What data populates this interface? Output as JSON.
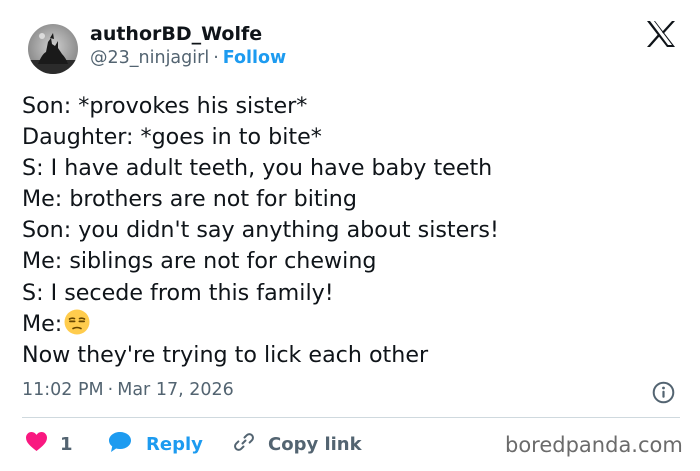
{
  "author": {
    "display_name": "authorBD_Wolfe",
    "handle": "@23_ninjagirl",
    "separator": "·",
    "follow_label": "Follow",
    "avatar_icon": "wolf-avatar"
  },
  "platform_logo": "x-logo-icon",
  "tweet": {
    "lines": [
      "Son: *provokes his sister*",
      "Daughter: *goes in to bite*",
      "S: I have adult teeth, you have baby teeth",
      "Me: brothers are not for biting",
      "Son: you didn't say anything about sisters!",
      "Me: siblings are not for chewing",
      "S: I secede from this family!",
      "Me:",
      "Now they're trying to lick each other"
    ],
    "emoji_after_line_8": "unamused-face-emoji"
  },
  "meta": {
    "time": "11:02 PM",
    "separator": "·",
    "date": "Mar 17, 2026"
  },
  "actions": {
    "like_count": "1",
    "reply_label": "Reply",
    "copy_link_label": "Copy link"
  },
  "watermark": "boredpanda.com",
  "colors": {
    "accent": "#1d9bf0",
    "like": "#f91880",
    "text": "#0f1419",
    "secondary": "#536471"
  }
}
